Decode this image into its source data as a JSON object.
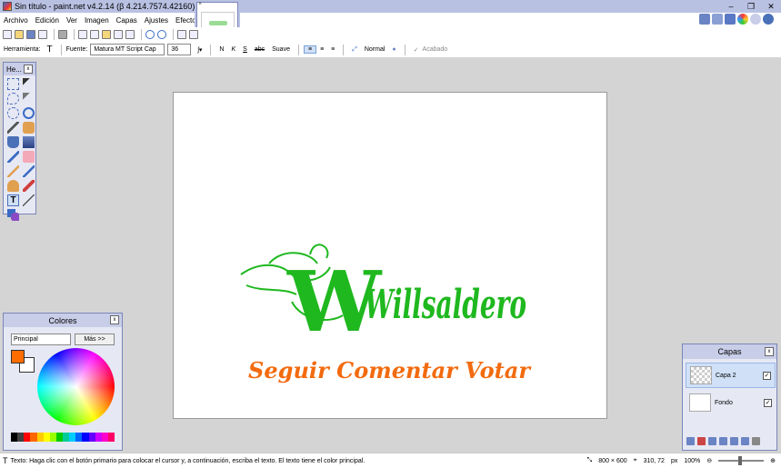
{
  "window": {
    "title": "Sin título - paint.net v4.2.14 (β 4.214.7574.42160)",
    "controls": [
      "–",
      "❐",
      "✕"
    ]
  },
  "menu": {
    "items": [
      "Archivo",
      "Edición",
      "Ver",
      "Imagen",
      "Capas",
      "Ajustes",
      "Efectos"
    ]
  },
  "tooloptions": {
    "tool_label": "Herramienta:",
    "tool_glyph": "T",
    "font_label": "Fuente:",
    "font_value": "Matura MT Script Cap",
    "size_value": "36",
    "bold": "N",
    "italic": "K",
    "underline": "S",
    "strike": "abc",
    "antialias": "Suave",
    "blend": "Normal",
    "finish": "Acabado"
  },
  "panels": {
    "tools_title": "He...",
    "colors_title": "Colores",
    "colors_mode": "Principal",
    "colors_more": "Más >>",
    "layers_title": "Capas",
    "layers": [
      "Capa 2",
      "Fondo"
    ],
    "close": "x"
  },
  "canvas": {
    "title_text": "Willsaldero",
    "title_initial": "W",
    "subtitle_text": "Seguir Comentar Votar",
    "title_color": "#1fb81f",
    "subtitle_color": "#f26b0f"
  },
  "colors": {
    "primary": "#ff6d00",
    "secondary": "#ffffff",
    "accent": "#b9c1e3"
  },
  "statusbar": {
    "hint": "Texto: Haga clic con el botón primario para colocar el cursor y, a continuación, escriba el texto. El texto tiene el color principal.",
    "image_size": "800 × 600",
    "cursor_pos": "310, 72",
    "unit": "px",
    "zoom": "100%"
  }
}
